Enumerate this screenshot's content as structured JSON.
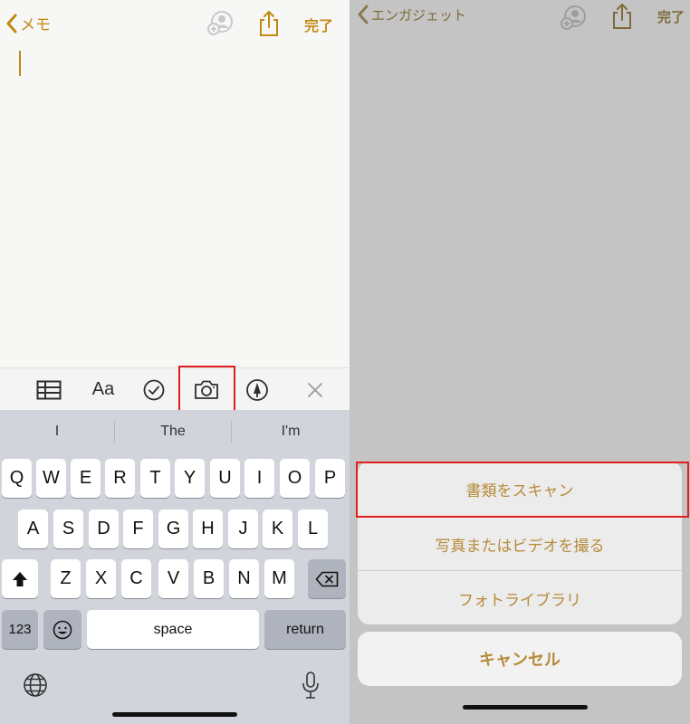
{
  "left": {
    "nav": {
      "back_label": "メモ",
      "done_label": "完了"
    },
    "toolbar": {
      "format_label": "Aa"
    },
    "suggestions": [
      "I",
      "The",
      "I'm"
    ],
    "keys": {
      "row1": [
        "Q",
        "W",
        "E",
        "R",
        "T",
        "Y",
        "U",
        "I",
        "O",
        "P"
      ],
      "row2": [
        "A",
        "S",
        "D",
        "F",
        "G",
        "H",
        "J",
        "K",
        "L"
      ],
      "row3": [
        "Z",
        "X",
        "C",
        "V",
        "B",
        "N",
        "M"
      ],
      "numbers_label": "123",
      "space_label": "space",
      "return_label": "return"
    }
  },
  "right": {
    "nav": {
      "back_label": "エンガジェット",
      "done_label": "完了"
    },
    "sheet": {
      "items": [
        "書類をスキャン",
        "写真またはビデオを撮る",
        "フォトライブラリ"
      ],
      "cancel_label": "キャンセル"
    }
  },
  "colors": {
    "accent": "#c28a14",
    "sheet_text": "#b68b3a",
    "highlight": "#e02020"
  }
}
